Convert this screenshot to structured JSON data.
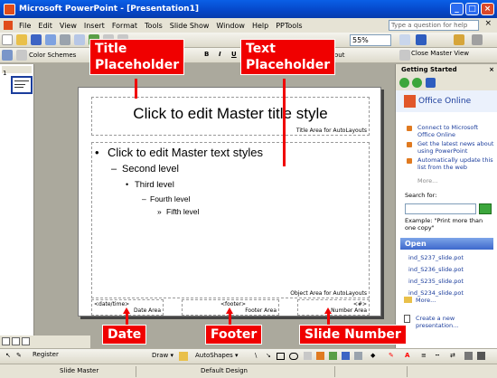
{
  "window": {
    "title": "Microsoft PowerPoint - [Presentation1]"
  },
  "menu": {
    "items": [
      "File",
      "Edit",
      "View",
      "Insert",
      "Format",
      "Tools",
      "Slide Show",
      "Window",
      "Help",
      "PPTools"
    ],
    "help_placeholder": "Type a question for help"
  },
  "toolbar": {
    "zoom": "55%",
    "color_schemes": "Color Schemes",
    "close_master_view": "Close Master View",
    "out_fragment": "out",
    "format_buttons": [
      "B",
      "I",
      "U"
    ]
  },
  "slide": {
    "title_text": "Click to edit Master title style",
    "title_area_label": "Title Area for AutoLayouts",
    "bullets": [
      {
        "text": "Click to edit Master text styles",
        "level": 1
      },
      {
        "text": "Second level",
        "level": 2
      },
      {
        "text": "Third level",
        "level": 3
      },
      {
        "text": "Fourth level",
        "level": 4
      },
      {
        "text": "Fifth level",
        "level": 5
      }
    ],
    "bullet_marks": [
      "•",
      "–",
      "•",
      "–",
      "»"
    ],
    "object_area_label": "Object Area for AutoLayouts",
    "date_field": "<date/time>",
    "date_area_label": "Date Area",
    "footer_field": "<footer>",
    "footer_area_label": "Footer Area",
    "number_field": "<#>",
    "number_area_label": "Number Area"
  },
  "slides_pane": {
    "thumb_number": "1"
  },
  "task_pane": {
    "title": "Getting Started",
    "office_online": "Office Online",
    "links": [
      "Connect to Microsoft Office Online",
      "Get the latest news about using PowerPoint",
      "Automatically update this list from the web"
    ],
    "more": "More...",
    "search_label": "Search for:",
    "example_text": "Example: \"Print more than one copy\"",
    "open_header": "Open",
    "files": [
      "ind_S237_slide.pot",
      "ind_S236_slide.pot",
      "ind_S235_slide.pot",
      "ind_S234_slide.pot"
    ],
    "files_more": "More...",
    "create_new": "Create a new presentation..."
  },
  "draw_toolbar": {
    "draw_label": "Draw ▾",
    "autoshapes_label": "AutoShapes ▾",
    "register": "Register"
  },
  "status_bar": {
    "view": "Slide Master",
    "design": "Default Design"
  },
  "annotations": {
    "title_placeholder": "Title\nPlaceholder",
    "text_placeholder": "Text\nPlaceholder",
    "date": "Date",
    "footer": "Footer",
    "slide_number": "Slide Number"
  },
  "colors": {
    "annotation_red": "#F00000",
    "titlebar_blue": "#0546C8",
    "link_blue": "#1B3D9C"
  }
}
